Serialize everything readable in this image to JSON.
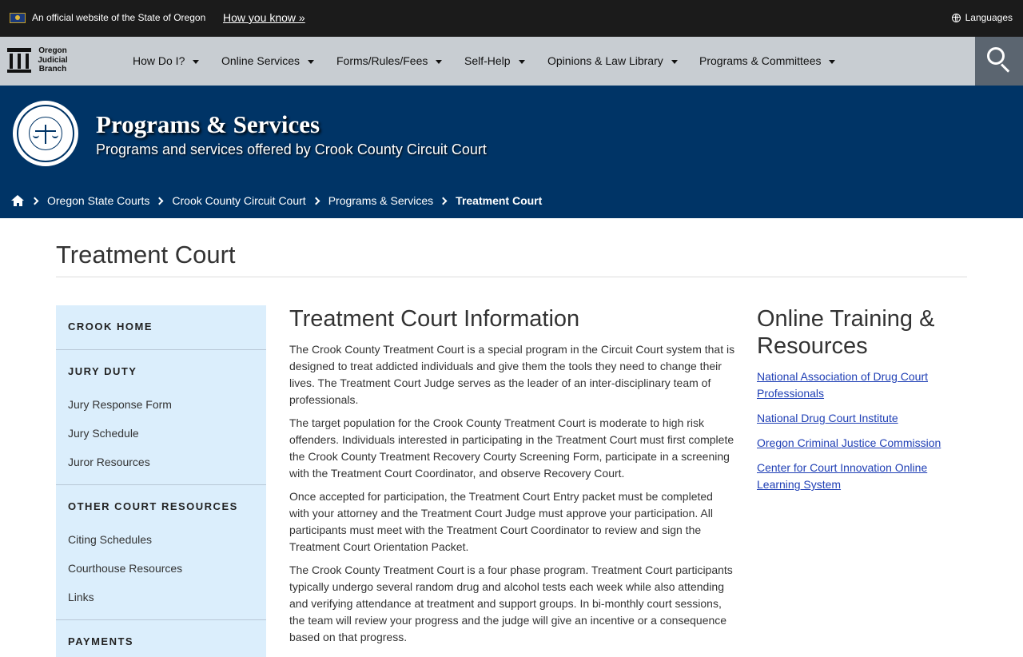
{
  "banner": {
    "official_text": "An official website of the State of Oregon",
    "how_you_know": "How you know »",
    "languages": "Languages"
  },
  "logo": {
    "line1": "Oregon",
    "line2": "Judicial",
    "line3": "Branch"
  },
  "nav": {
    "items": [
      {
        "label": "How Do I?"
      },
      {
        "label": "Online Services"
      },
      {
        "label": "Forms/Rules/Fees"
      },
      {
        "label": "Self-Help"
      },
      {
        "label": "Opinions & Law Library"
      },
      {
        "label": "Programs & Committees"
      }
    ]
  },
  "hero": {
    "title": "Programs & Services",
    "subtitle": "Programs and services offered by Crook County Circuit Court"
  },
  "breadcrumbs": [
    "Oregon State Courts",
    "Crook County Circuit Court",
    "Programs & Services",
    "Treatment Court"
  ],
  "page_title": "Treatment Court",
  "sidebar": {
    "sections": [
      {
        "heading": "CROOK HOME",
        "links": []
      },
      {
        "heading": "JURY DUTY",
        "links": [
          "Jury Response Form",
          "Jury Schedule",
          "Juror Resources"
        ]
      },
      {
        "heading": "OTHER COURT RESOURCES",
        "links": [
          "Citing Schedules",
          "Courthouse Resources",
          "Links"
        ]
      },
      {
        "heading": "PAYMENTS",
        "links": []
      }
    ]
  },
  "main": {
    "heading": "Treatment Court Information",
    "paragraphs": [
      "The Crook County Treatment Court is a special program in the Circuit Court system that is designed to treat addicted individuals and give them the tools they need to change their lives. The Treatment Court Judge serves as the leader of an inter-disciplinary team of professionals.",
      "The target population for the Crook County Treatment Court is moderate to high risk offenders. Individuals interested in participating in the Treatment Court must first complete the Crook County Treatment Recovery Courty Screening Form, participate in a screening with the Treatment Court Coordinator, and observe Recovery Court.",
      "Once accepted for participation, the Treatment Court Entry packet must be completed with your attorney and the Treatment Court Judge must approve your participation. All participants must meet with the Treatment Court Coordinator to review and sign the Treatment Court Orientation Packet.",
      "The Crook County Treatment Court is a four phase program. Treatment Court participants typically undergo several random drug and alcohol tests each week while also attending and verifying attendance at treatment and support groups. In bi-monthly court sessions, the team will review your progress and the judge will give an incentive or a consequence based on that progress."
    ]
  },
  "right": {
    "heading": "Online Training & Resources",
    "links": [
      "National Association of Drug Court Professionals",
      "National Drug Court Institute",
      "Oregon Criminal Justice Commission",
      "Center for Court Innovation Online Learning System"
    ]
  }
}
